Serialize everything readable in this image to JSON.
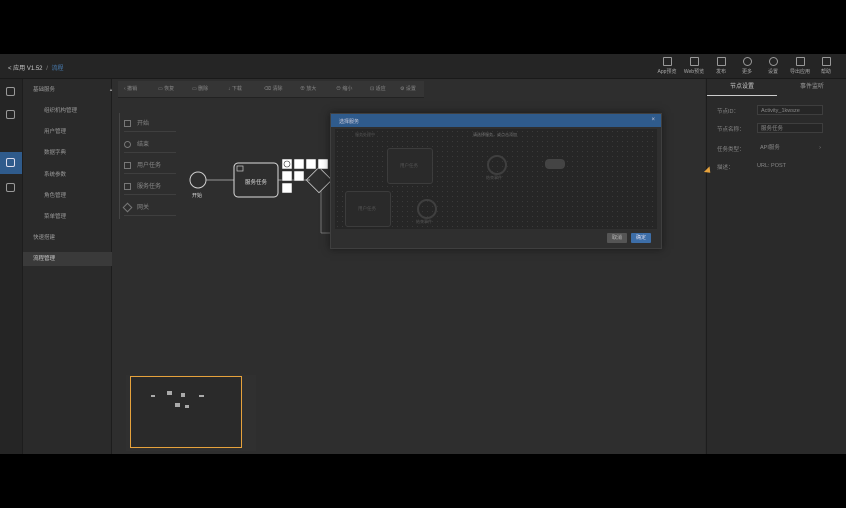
{
  "header": {
    "back_label": "< 应用 V1.52",
    "sep": "/",
    "current": "流程",
    "actions": [
      "App预览",
      "Web预览",
      "发布",
      "更多",
      "设置",
      "导出应用",
      "帮助"
    ]
  },
  "sidebar": {
    "items": [
      {
        "label": "基础服务",
        "expand_icon": "▲"
      },
      {
        "label": "组织机构管理"
      },
      {
        "label": "用户管理"
      },
      {
        "label": "数据字典"
      },
      {
        "label": "系统参数"
      },
      {
        "label": "角色管理"
      },
      {
        "label": "菜单管理"
      },
      {
        "label": "快速搭建"
      },
      {
        "label": "流程管理"
      }
    ]
  },
  "toolbar": {
    "items": [
      "撤销",
      "恢复",
      "删除",
      "下载",
      "清除",
      "放大",
      "缩小",
      "适应",
      "设置"
    ]
  },
  "palette": {
    "items": [
      "开始",
      "结束",
      "用户任务",
      "服务任务",
      "网关"
    ]
  },
  "diagram": {
    "start_label": "开始",
    "service_task_label": "服务任务"
  },
  "dialog": {
    "title": "选择服务",
    "close": "×",
    "hint": "请选择服务，或点击添加",
    "sub_label": "服务处理中",
    "node_user_task": "用户任务",
    "node_end": "结束事件",
    "node_user_task_2": "用户任务",
    "node_end_2": "结束事件",
    "cancel": "取消",
    "ok": "确定"
  },
  "right_panel": {
    "tabs": [
      "节点设置",
      "事件监听"
    ],
    "fields": [
      {
        "label": "节点ID：",
        "value": "Activity_1kwsze"
      },
      {
        "label": "节点名称：",
        "value": "服务任务"
      },
      {
        "label": "任务类型：",
        "value": "API服务"
      },
      {
        "label": "描述：",
        "value": "URL: POST"
      }
    ]
  }
}
